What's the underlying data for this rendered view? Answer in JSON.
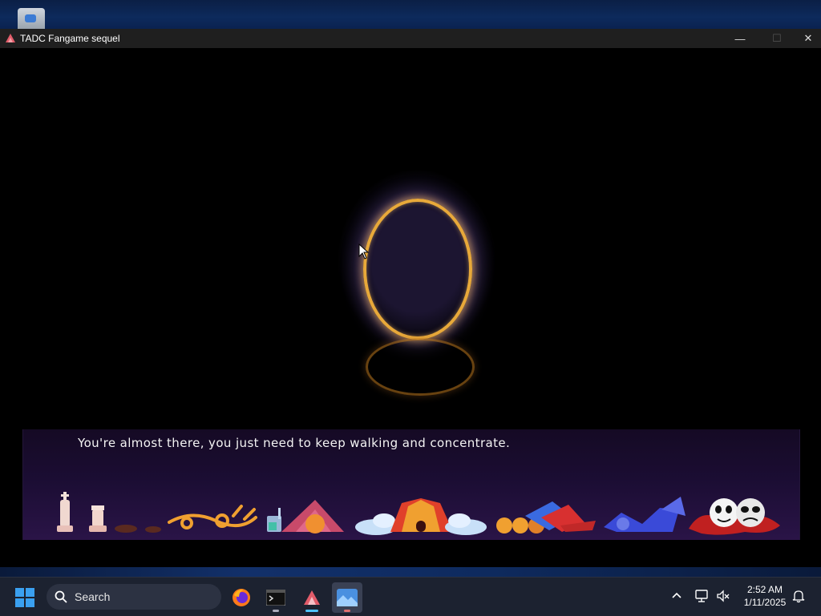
{
  "window": {
    "title": "TADC Fangame sequel",
    "controls": {
      "minimize": "—",
      "maximize": "☐",
      "close": "✕"
    }
  },
  "game": {
    "dialogue": "You're almost there, you just need to keep walking and concentrate."
  },
  "taskbar": {
    "search_label": "Search",
    "apps": [
      "firefox-icon",
      "terminal-icon",
      "game-app-icon",
      "image-viewer-icon"
    ],
    "clock": {
      "time": "2:52 AM",
      "date": "1/11/2025"
    }
  },
  "colors": {
    "portal_ring": "#e8a93a",
    "dialogue_bg": "#1b0d33",
    "taskbar_bg": "#1c2230",
    "accent_indicator": "#4cc2ff"
  }
}
